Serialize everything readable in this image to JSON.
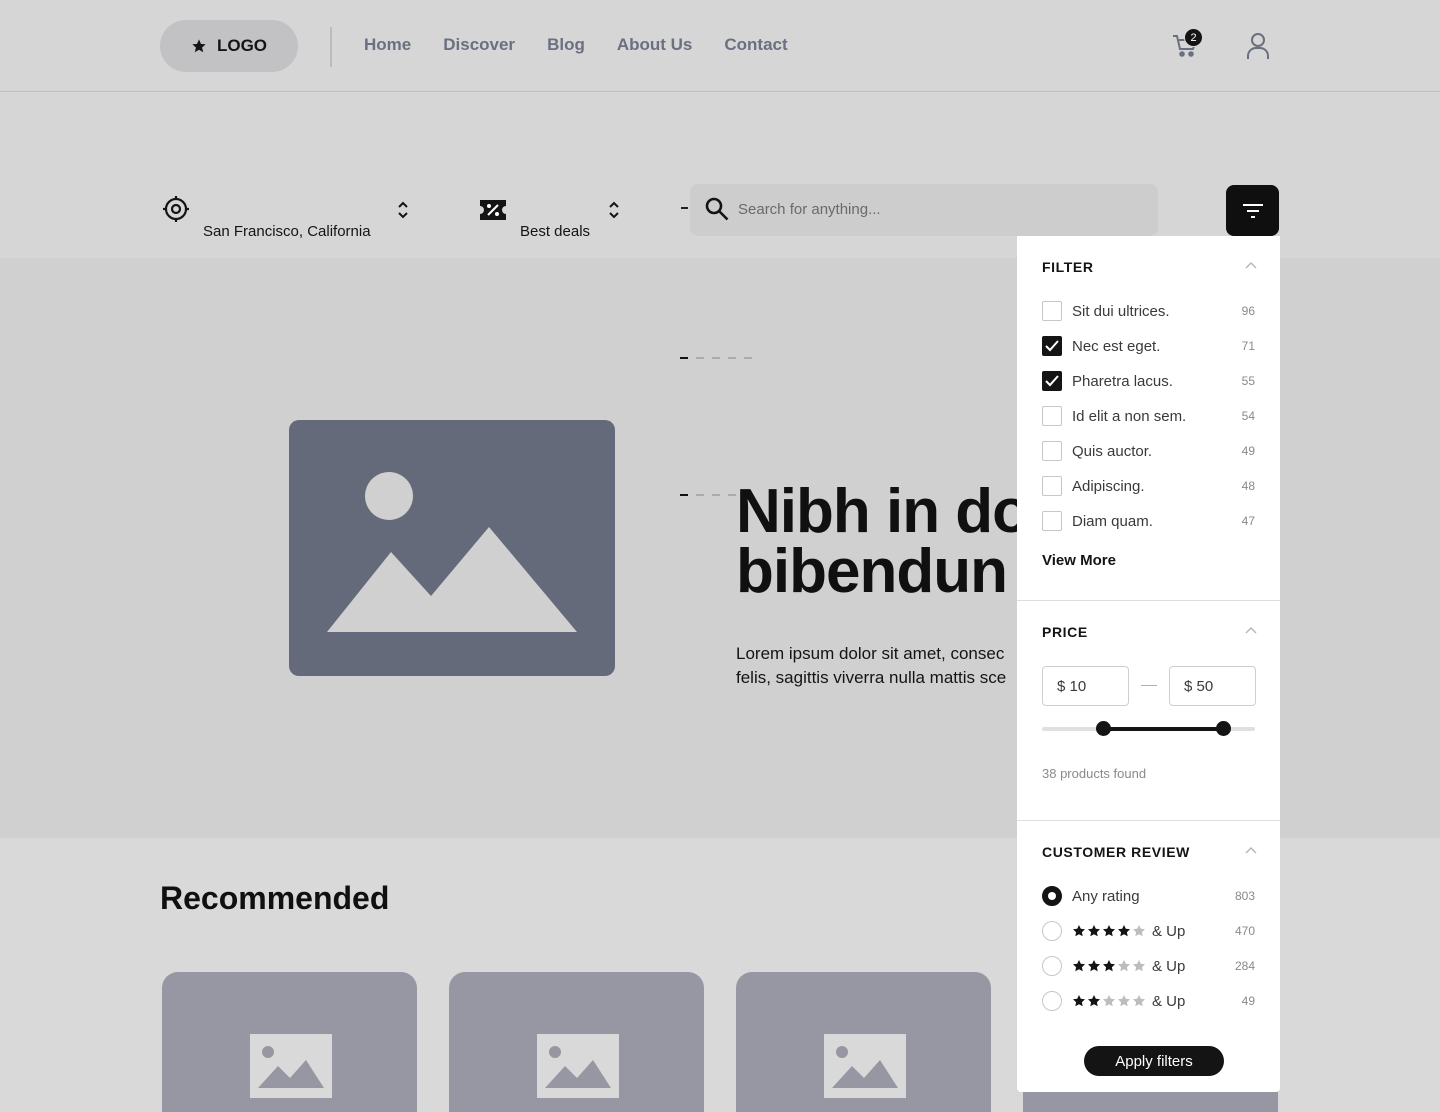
{
  "nav": {
    "logo": "LOGO",
    "links": [
      "Home",
      "Discover",
      "Blog",
      "About Us",
      "Contact"
    ],
    "cart_count": "2"
  },
  "search_bar": {
    "location": "San Francisco, California",
    "deals": "Best deals",
    "placeholder": "Search for anything..."
  },
  "hero": {
    "title": "Nibh in do\nbibendun",
    "subtitle": "Lorem ipsum dolor sit amet, consec\nfelis, sagittis viverra nulla mattis sce"
  },
  "recommended": {
    "title": "Recommended"
  },
  "filter_panel": {
    "filter": {
      "title": "FILTER",
      "items": [
        {
          "label": "Sit dui ultrices.",
          "count": "96",
          "checked": false
        },
        {
          "label": "Nec est eget.",
          "count": "71",
          "checked": true
        },
        {
          "label": "Pharetra lacus.",
          "count": "55",
          "checked": true
        },
        {
          "label": "Id elit a non sem.",
          "count": "54",
          "checked": false
        },
        {
          "label": "Quis auctor.",
          "count": "49",
          "checked": false
        },
        {
          "label": "Adipiscing.",
          "count": "48",
          "checked": false
        },
        {
          "label": "Diam quam.",
          "count": "47",
          "checked": false
        }
      ],
      "view_more": "View More"
    },
    "price": {
      "title": "PRICE",
      "min": "$ 10",
      "max": "$ 50",
      "range_min_fraction": 0.29,
      "range_max_fraction": 0.85,
      "found": "38 products found"
    },
    "review": {
      "title": "CUSTOMER REVIEW",
      "items": [
        {
          "label": "Any rating",
          "count": "803",
          "stars": 0,
          "selected": true
        },
        {
          "label": "& Up",
          "count": "470",
          "stars": 4,
          "selected": false
        },
        {
          "label": "& Up",
          "count": "284",
          "stars": 3,
          "selected": false
        },
        {
          "label": "& Up",
          "count": "49",
          "stars": 2,
          "selected": false
        }
      ]
    },
    "apply": "Apply filters"
  }
}
